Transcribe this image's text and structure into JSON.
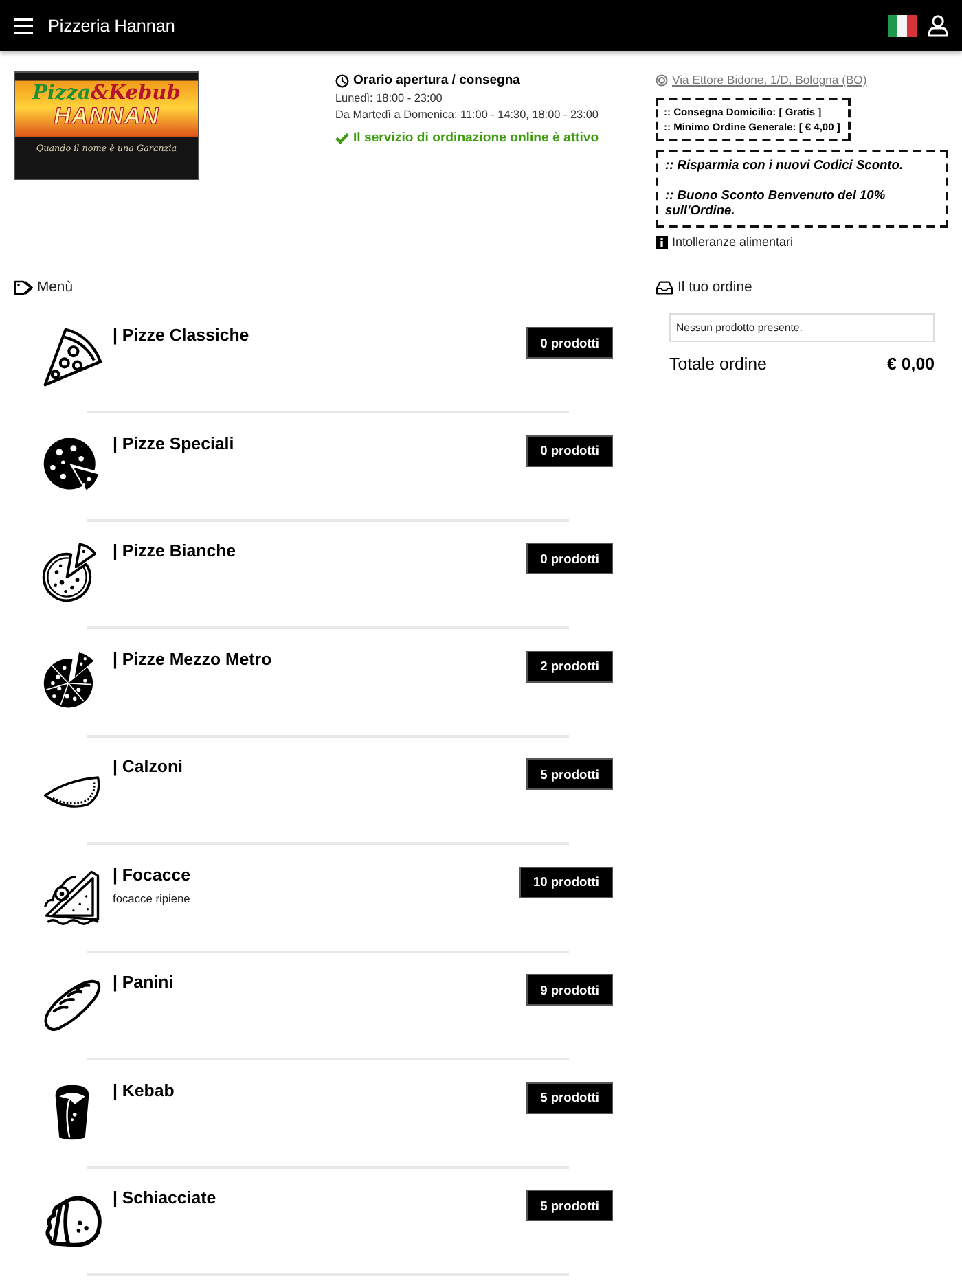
{
  "header": {
    "title": "Pizzeria Hannan"
  },
  "logo": {
    "wordmark": [
      {
        "text": "Pizza",
        "color": "#1f8f35"
      },
      {
        "text": "&Kebub",
        "color": "#b5142c"
      }
    ],
    "name": "HANNAN",
    "tagline": "Quando il nome è una Garanzia"
  },
  "hours": {
    "title": "Orario apertura / consegna",
    "lines": [
      "Lunedì: 18:00 - 23:00",
      "Da Martedì a Domenica: 11:00 - 14:30, 18:00 - 23:00"
    ],
    "status": "Il servizio di ordinazione online è attivo"
  },
  "info": {
    "address": "Via Ettore Bidone, 1/D, Bologna (BO)",
    "delivery_notes": [
      ":: Consegna Domicilio: [ Gratis ]",
      ":: Minimo Ordine Generale: [ € 4,00 ]"
    ],
    "promo_notes": [
      ":: Risparmia con i nuovi Codici Sconto.",
      ":: Buono Sconto Benvenuto del 10% sull'Ordine."
    ],
    "allergens_link": "Intolleranze alimentari"
  },
  "menu": {
    "title": "Menù",
    "categories": [
      {
        "name": "| Pizze Classiche",
        "count": "0 prodotti"
      },
      {
        "name": "| Pizze Speciali",
        "count": "0 prodotti"
      },
      {
        "name": "| Pizze Bianche",
        "count": "0 prodotti"
      },
      {
        "name": "| Pizze Mezzo Metro",
        "count": "2 prodotti"
      },
      {
        "name": "| Calzoni",
        "count": "5 prodotti"
      },
      {
        "name": "| Focacce",
        "description": "focacce ripiene",
        "count": "10 prodotti"
      },
      {
        "name": "| Panini",
        "count": "9 prodotti"
      },
      {
        "name": "| Kebab",
        "count": "5 prodotti"
      },
      {
        "name": "| Schiacciate",
        "count": "5 prodotti"
      }
    ]
  },
  "order": {
    "title": "Il tuo ordine",
    "empty_message": "Nessun prodotto presente.",
    "total_label": "Totale ordine",
    "total": "€ 0,00"
  }
}
